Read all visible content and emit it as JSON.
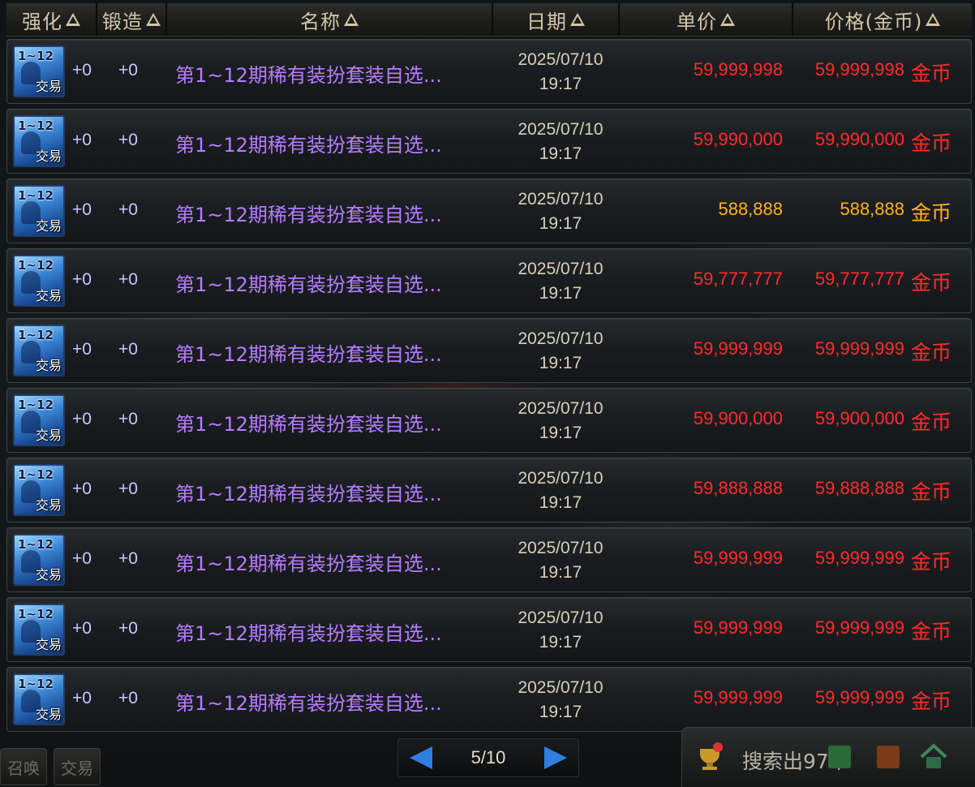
{
  "header": {
    "columns": [
      {
        "key": "enhance",
        "label": "强化"
      },
      {
        "key": "forge",
        "label": "锻造"
      },
      {
        "key": "name",
        "label": "名称"
      },
      {
        "key": "date",
        "label": "日期"
      },
      {
        "key": "unit_price",
        "label": "单价"
      },
      {
        "key": "price",
        "label": "价格(金币)"
      }
    ]
  },
  "listings": [
    {
      "icon_range": "1~12",
      "icon_tag": "交易",
      "enhance": "+0",
      "forge": "+0",
      "name": "第1~12期稀有装扮套装自选...",
      "date": "2025/07/10",
      "time": "19:17",
      "unit_price": "59,999,998",
      "price": "59,999,998",
      "currency": "金币",
      "price_color": "#ff2b2b"
    },
    {
      "icon_range": "1~12",
      "icon_tag": "交易",
      "enhance": "+0",
      "forge": "+0",
      "name": "第1~12期稀有装扮套装自选...",
      "date": "2025/07/10",
      "time": "19:17",
      "unit_price": "59,990,000",
      "price": "59,990,000",
      "currency": "金币",
      "price_color": "#ff2b2b"
    },
    {
      "icon_range": "1~12",
      "icon_tag": "交易",
      "enhance": "+0",
      "forge": "+0",
      "name": "第1~12期稀有装扮套装自选...",
      "date": "2025/07/10",
      "time": "19:17",
      "unit_price": "588,888",
      "price": "588,888",
      "currency": "金币",
      "price_color": "#ffb21c"
    },
    {
      "icon_range": "1~12",
      "icon_tag": "交易",
      "enhance": "+0",
      "forge": "+0",
      "name": "第1~12期稀有装扮套装自选...",
      "date": "2025/07/10",
      "time": "19:17",
      "unit_price": "59,777,777",
      "price": "59,777,777",
      "currency": "金币",
      "price_color": "#ff2b2b"
    },
    {
      "icon_range": "1~12",
      "icon_tag": "交易",
      "enhance": "+0",
      "forge": "+0",
      "name": "第1~12期稀有装扮套装自选...",
      "date": "2025/07/10",
      "time": "19:17",
      "unit_price": "59,999,999",
      "price": "59,999,999",
      "currency": "金币",
      "price_color": "#ff2b2b"
    },
    {
      "icon_range": "1~12",
      "icon_tag": "交易",
      "enhance": "+0",
      "forge": "+0",
      "name": "第1~12期稀有装扮套装自选...",
      "date": "2025/07/10",
      "time": "19:17",
      "unit_price": "59,900,000",
      "price": "59,900,000",
      "currency": "金币",
      "price_color": "#ff2b2b"
    },
    {
      "icon_range": "1~12",
      "icon_tag": "交易",
      "enhance": "+0",
      "forge": "+0",
      "name": "第1~12期稀有装扮套装自选...",
      "date": "2025/07/10",
      "time": "19:17",
      "unit_price": "59,888,888",
      "price": "59,888,888",
      "currency": "金币",
      "price_color": "#ff2b2b"
    },
    {
      "icon_range": "1~12",
      "icon_tag": "交易",
      "enhance": "+0",
      "forge": "+0",
      "name": "第1~12期稀有装扮套装自选...",
      "date": "2025/07/10",
      "time": "19:17",
      "unit_price": "59,999,999",
      "price": "59,999,999",
      "currency": "金币",
      "price_color": "#ff2b2b"
    },
    {
      "icon_range": "1~12",
      "icon_tag": "交易",
      "enhance": "+0",
      "forge": "+0",
      "name": "第1~12期稀有装扮套装自选...",
      "date": "2025/07/10",
      "time": "19:17",
      "unit_price": "59,999,999",
      "price": "59,999,999",
      "currency": "金币",
      "price_color": "#ff2b2b"
    },
    {
      "icon_range": "1~12",
      "icon_tag": "交易",
      "enhance": "+0",
      "forge": "+0",
      "name": "第1~12期稀有装扮套装自选...",
      "date": "2025/07/10",
      "time": "19:17",
      "unit_price": "59,999,999",
      "price": "59,999,999",
      "currency": "金币",
      "price_color": "#ff2b2b"
    }
  ],
  "pager": {
    "current_page": "5",
    "total_pages": "10",
    "label": "5/10",
    "prev_icon": "left-arrow-icon",
    "next_icon": "right-arrow-icon"
  },
  "status": {
    "search_result": "搜索出97个",
    "icons": [
      "trophy-icon",
      "home-icon"
    ]
  },
  "bottom_tabs": [
    "召唤",
    "交易"
  ],
  "colors": {
    "header_text": "#d4c7a6",
    "item_name": "#b57dff",
    "price_high": "#ff2b2b",
    "price_low": "#ffb21c",
    "arrow": "#2f7fe0"
  }
}
